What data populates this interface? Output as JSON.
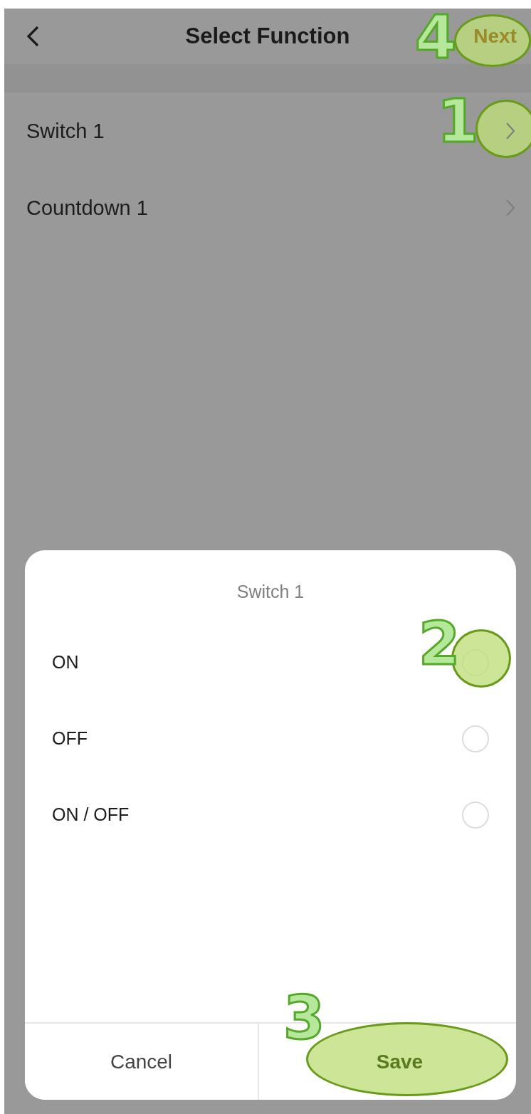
{
  "header": {
    "title": "Select Function",
    "action": "Next"
  },
  "functions": [
    {
      "label": "Switch 1"
    },
    {
      "label": "Countdown 1"
    }
  ],
  "sheet": {
    "title": "Switch 1",
    "options": [
      {
        "label": "ON",
        "selected": false
      },
      {
        "label": "OFF",
        "selected": false
      },
      {
        "label": "ON / OFF",
        "selected": false
      }
    ],
    "buttons": [
      {
        "label": "Cancel",
        "kind": "cancel"
      },
      {
        "label": "Save",
        "kind": "confirm"
      }
    ]
  },
  "annotations": [
    {
      "number": "4"
    },
    {
      "number": "1"
    },
    {
      "number": "2"
    },
    {
      "number": "3"
    }
  ]
}
